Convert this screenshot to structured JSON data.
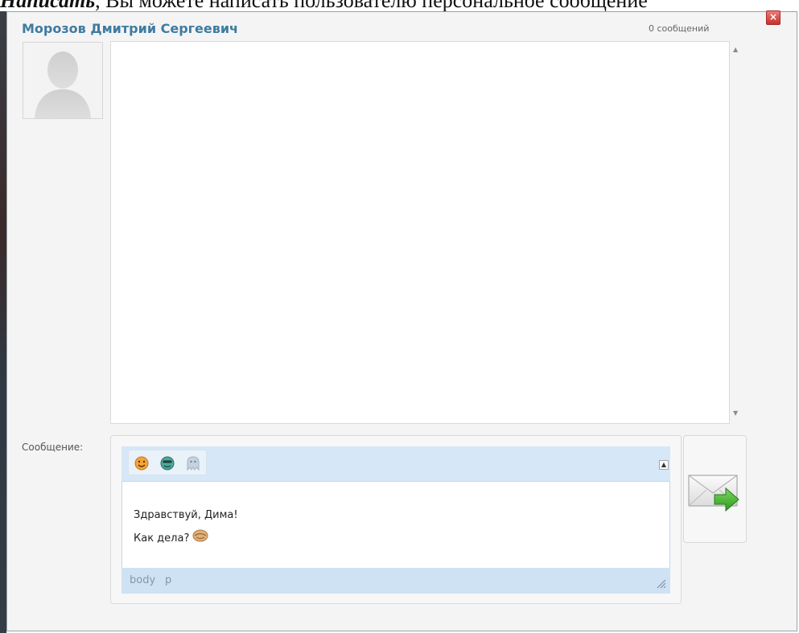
{
  "caption": {
    "strong": "Написать",
    "text": ", Вы можете написать пользователю персональное сообщение"
  },
  "dialog": {
    "close_label": "×",
    "user_name": "Морозов Дмитрий Сергеевич",
    "message_count": "0 сообщений",
    "history": {
      "scroll_up": "▲",
      "scroll_down": "▼"
    },
    "compose": {
      "label": "Сообщение:",
      "emoji_icons": [
        "smiley-icon",
        "cool-smiley-icon",
        "ghost-smiley-icon"
      ],
      "collapse_label": "▲",
      "text_line1": "Здравствуй, Дима!",
      "text_line2": "Как дела?",
      "inline_emoji": "handshake-smiley-icon",
      "path": [
        "body",
        "p"
      ]
    },
    "send_icon": "send-envelope-icon"
  },
  "colors": {
    "name": "#3e7ba1",
    "toolbar": "#d6e7f7",
    "statusbar": "#cfe2f4",
    "close": "#d9433f",
    "arrow": "#3fae2a"
  }
}
